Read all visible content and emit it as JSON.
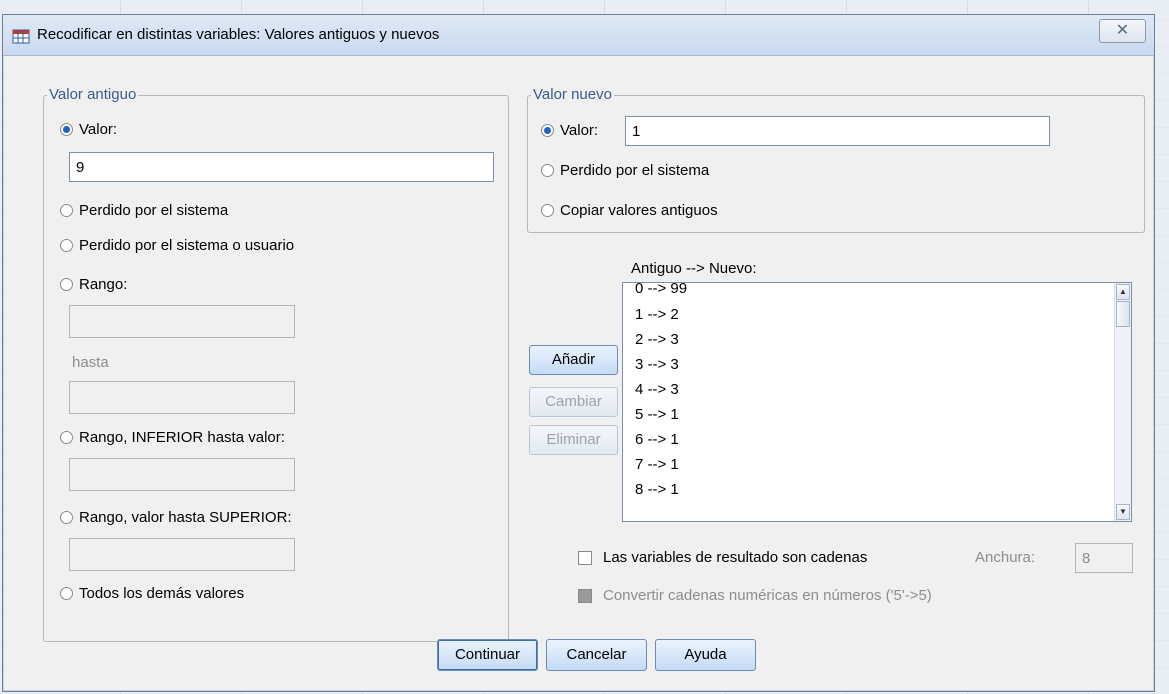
{
  "window": {
    "title": "Recodificar en distintas variables: Valores antiguos y nuevos",
    "close_glyph": "✕"
  },
  "old_value": {
    "legend": "Valor antiguo",
    "valor_label": "Valor:",
    "valor_value": "9",
    "system_missing_label": "Perdido por el sistema",
    "system_user_missing_label": "Perdido por el sistema o usuario",
    "range_label": "Rango:",
    "through_label": "hasta",
    "range_lowest_label": "Rango, INFERIOR hasta valor:",
    "range_highest_label": "Rango, valor hasta SUPERIOR:",
    "all_other_label": "Todos los demás valores",
    "selected": "valor"
  },
  "new_value": {
    "legend": "Valor nuevo",
    "valor_label": "Valor:",
    "valor_value": "1",
    "system_missing_label": "Perdido por el sistema",
    "copy_old_label": "Copiar valores antiguos",
    "selected": "valor"
  },
  "mapping": {
    "header": "Antiguo --> Nuevo:",
    "items": [
      "0 --> 99",
      "1 --> 2",
      "2 --> 3",
      "3 --> 3",
      "4 --> 3",
      "5 --> 1",
      "6 --> 1",
      "7 --> 1",
      "8 --> 1"
    ]
  },
  "actions": {
    "add": "Añadir",
    "change": "Cambiar",
    "remove": "Eliminar"
  },
  "options": {
    "output_strings_label": "Las variables de resultado son cadenas",
    "width_label": "Anchura:",
    "width_value": "8",
    "convert_label": "Convertir cadenas numéricas en números ('5'->5)"
  },
  "footer": {
    "continue": "Continuar",
    "cancel": "Cancelar",
    "help": "Ayuda"
  },
  "colors": {
    "accent": "#1e62c7",
    "legend": "#3a5a8c"
  }
}
